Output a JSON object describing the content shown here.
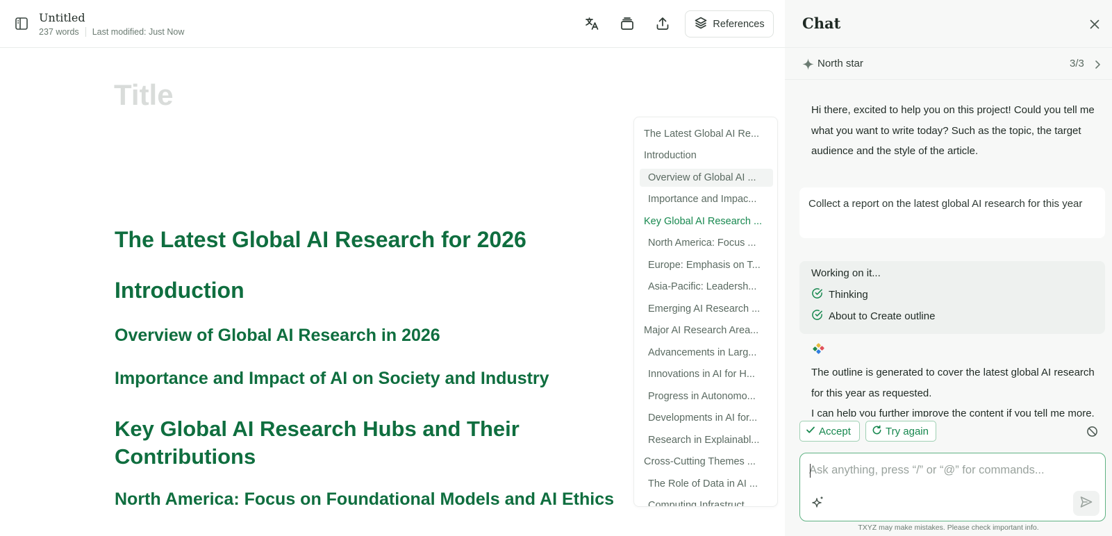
{
  "editor": {
    "doc_title": "Untitled",
    "word_count": "237 words",
    "last_modified": "Last modified: Just Now",
    "references_label": "References",
    "title_placeholder": "Title",
    "headings": [
      "The Latest Global AI Research for 2026",
      "Introduction",
      "Overview of Global AI Research in 2026",
      "Importance and Impact of AI on Society and Industry",
      "Key Global AI Research Hubs and Their Contributions",
      "North America: Focus on Foundational Models and AI Ethics"
    ]
  },
  "outline": {
    "items": [
      "The Latest Global AI Re...",
      "Introduction",
      "Overview of Global AI ...",
      "Importance and Impac...",
      "Key Global AI Research ...",
      "North America: Focus ...",
      "Europe: Emphasis on T...",
      "Asia-Pacific: Leadersh...",
      "Emerging AI Research ...",
      "Major AI Research Area...",
      "Advancements in Larg...",
      "Innovations in AI for H...",
      "Progress in Autonomo...",
      "Developments in AI for...",
      "Research in Explainabl...",
      "Cross-Cutting Themes ...",
      "The Role of Data in AI ...",
      "Computing Infrastruct..."
    ],
    "active_item": "Key Global AI Research ..."
  },
  "chat": {
    "title": "Chat",
    "north_star_label": "North star",
    "north_star_count": "3/3",
    "assistant_greeting": "Hi there, excited to help you on this project! Could you tell me what you want to write today? Such as the topic, the target audience and the style of the article.",
    "user_message": "Collect a report on the latest global AI research for this year",
    "working_title": "Working on it...",
    "steps": [
      "Thinking",
      "About to Create outline"
    ],
    "reply": "The outline is generated to cover the latest global AI research for this year as requested.\nI can help you further improve the content if you tell me more.",
    "accept_label": "Accept",
    "try_again_label": "Try again",
    "input_placeholder": "Ask anything, press “/” or “@” for commands...",
    "input_value": "",
    "disclaimer": "TXYZ may make mistakes. Please check important info."
  },
  "colors": {
    "brand_green": "#0f6e3f",
    "accent_green": "#17884f",
    "title_placeholder": "#d9dcda"
  }
}
